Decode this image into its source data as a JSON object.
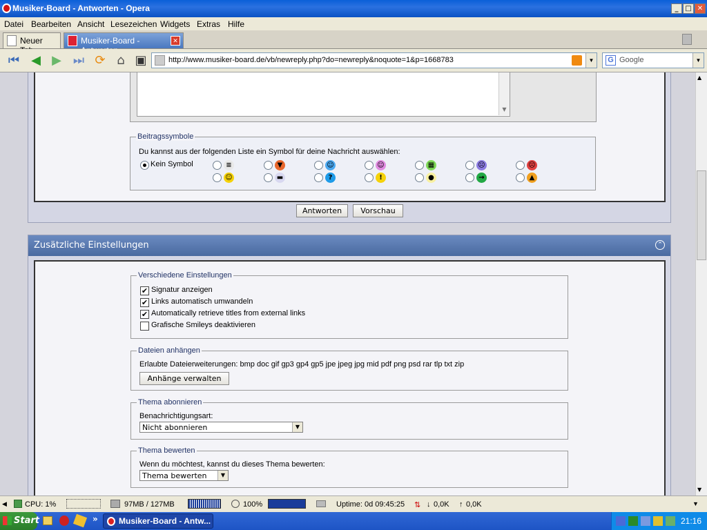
{
  "window": {
    "title": "Musiker-Board - Antworten - Opera",
    "minimize": "_",
    "maximize": "□",
    "close": "✕"
  },
  "menu": [
    "Datei",
    "Bearbeiten",
    "Ansicht",
    "Lesezeichen",
    "Widgets",
    "Extras",
    "Hilfe"
  ],
  "tabs": [
    {
      "label": "Neuer Tab"
    },
    {
      "label": "Musiker-Board - Antworten"
    }
  ],
  "nav": {
    "url": "http://www.musiker-board.de/vb/newreply.php?do=newreply&noquote=1&p=1668783",
    "search_placeholder": "Google"
  },
  "post_icons": {
    "legend": "Beitragssymbole",
    "instruction": "Du kannst aus der folgenden Liste ein Symbol für deine Nachricht auswählen:",
    "none_label": "Kein Symbol",
    "icons_row1": [
      {
        "name": "document-icon",
        "glyph": "≡",
        "color": "#e8e8e8"
      },
      {
        "name": "thumbs-down-icon",
        "glyph": "▼",
        "color": "#e8672c"
      },
      {
        "name": "smile-blue-icon",
        "glyph": "☺",
        "color": "#4aa8f0"
      },
      {
        "name": "smile-pink-icon",
        "glyph": "☺",
        "color": "#e08ae0"
      },
      {
        "name": "grin-icon",
        "glyph": "▦",
        "color": "#7ed957"
      },
      {
        "name": "sad-icon",
        "glyph": "☹",
        "color": "#8a7ae0"
      },
      {
        "name": "angry-icon",
        "glyph": "☹",
        "color": "#e04040"
      }
    ],
    "icons_row2": [
      {
        "name": "smile-icon",
        "glyph": "☺",
        "color": "#f5d20a"
      },
      {
        "name": "cool-icon",
        "glyph": "▬",
        "color": "#d8d8f0"
      },
      {
        "name": "question-icon",
        "glyph": "?",
        "color": "#1e9be8"
      },
      {
        "name": "warning-icon",
        "glyph": "!",
        "color": "#f5d20a"
      },
      {
        "name": "idea-icon",
        "glyph": "●",
        "color": "#f8f0a0"
      },
      {
        "name": "arrow-icon",
        "glyph": "→",
        "color": "#22a844"
      },
      {
        "name": "thumbs-up-icon",
        "glyph": "▲",
        "color": "#f0a020"
      }
    ]
  },
  "buttons": {
    "submit": "Antworten",
    "preview": "Vorschau"
  },
  "extra": {
    "header": "Zusätzliche Einstellungen",
    "misc": {
      "legend": "Verschiedene Einstellungen",
      "options": [
        {
          "label": "Signatur anzeigen",
          "checked": true
        },
        {
          "label": "Links automatisch umwandeln",
          "checked": true
        },
        {
          "label": "Automatically retrieve titles from external links",
          "checked": true
        },
        {
          "label": "Grafische Smileys deaktivieren",
          "checked": false
        }
      ]
    },
    "attach": {
      "legend": "Dateien anhängen",
      "allowed": "Erlaubte Dateierweiterungen: bmp doc gif gp3 gp4 gp5 jpe jpeg jpg mid pdf png psd rar tlp txt zip",
      "button": "Anhänge verwalten"
    },
    "subscribe": {
      "legend": "Thema abonnieren",
      "label": "Benachrichtigungsart:",
      "value": "Nicht abonnieren"
    },
    "rate": {
      "legend": "Thema bewerten",
      "label": "Wenn du möchtest, kannst du dieses Thema bewerten:",
      "value": "Thema bewerten"
    }
  },
  "status": {
    "cpu": "CPU: 1%",
    "memory": "97MB / 127MB",
    "zoom": "100%",
    "uptime": "Uptime: 0d 09:45:25",
    "down": "0,0K",
    "up": "0,0K"
  },
  "taskbar": {
    "start": "Start",
    "task": "Musiker-Board - Antw...",
    "clock": "21:16"
  },
  "colors": {
    "header_blue": "#5373a8",
    "link_blue": "#223366"
  }
}
